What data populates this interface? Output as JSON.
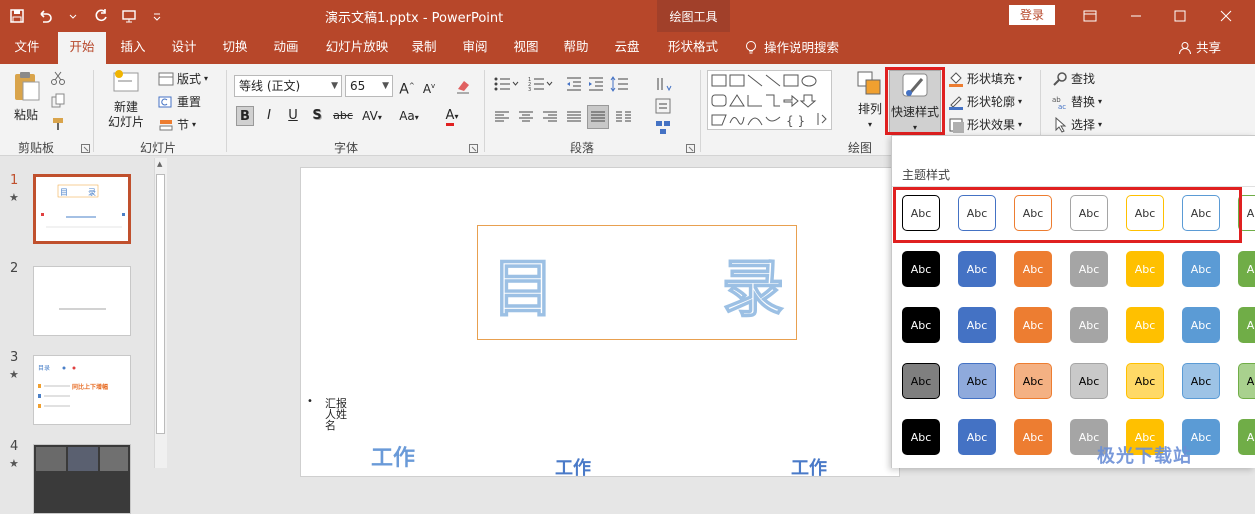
{
  "app": {
    "document_title": "演示文稿1.pptx  -  PowerPoint",
    "context_group": "绘图工具",
    "login_label": "登录"
  },
  "tabs": [
    {
      "label": "文件"
    },
    {
      "label": "开始"
    },
    {
      "label": "插入"
    },
    {
      "label": "设计"
    },
    {
      "label": "切换"
    },
    {
      "label": "动画"
    },
    {
      "label": "幻灯片放映"
    },
    {
      "label": "录制"
    },
    {
      "label": "审阅"
    },
    {
      "label": "视图"
    },
    {
      "label": "帮助"
    },
    {
      "label": "云盘"
    },
    {
      "label": "形状格式"
    }
  ],
  "tell_me": "操作说明搜索",
  "share": "共享",
  "ribbon": {
    "clipboard": {
      "label": "剪贴板",
      "paste": "粘贴"
    },
    "slides": {
      "label": "幻灯片",
      "new_slide": "新建\n幻灯片",
      "layout": "版式",
      "reset": "重置",
      "section": "节"
    },
    "font": {
      "label": "字体",
      "font_name": "等线 (正文)",
      "font_size": "65",
      "bold": "B",
      "italic": "I",
      "underline": "U",
      "shadow": "S",
      "strike": "abc",
      "spacing": "AV",
      "case": "Aa",
      "color": "A"
    },
    "paragraph": {
      "label": "段落"
    },
    "drawing": {
      "label": "绘图",
      "arrange": "排列",
      "quick_styles": "快速样式",
      "shape_fill": "形状填充",
      "shape_outline": "形状轮廓",
      "shape_effects": "形状效果"
    },
    "editing": {
      "find": "查找",
      "replace": "替换",
      "select": "选择"
    }
  },
  "slides_panel": [
    {
      "num": "1",
      "star": "★"
    },
    {
      "num": "2",
      "star": ""
    },
    {
      "num": "3",
      "star": "★"
    },
    {
      "num": "4",
      "star": "★"
    }
  ],
  "slide": {
    "title_left": "目",
    "title_right": "录",
    "bullet": "•",
    "reporter": "汇报\n人姓\n名",
    "work1": "工作",
    "work2": "工作",
    "work3": "工作"
  },
  "quick_styles": {
    "heading": "主题样式",
    "abc": "Abc",
    "rows": [
      [
        "#ffffff",
        "#ffffff",
        "#ffffff",
        "#ffffff",
        "#ffffff",
        "#ffffff",
        "#ffffff"
      ],
      [
        "#000000",
        "#4472c4",
        "#ed7d31",
        "#a5a5a5",
        "#ffc000",
        "#5b9bd5",
        "#70ad47"
      ],
      [
        "#000000",
        "#4472c4",
        "#ed7d31",
        "#a5a5a5",
        "#ffc000",
        "#5b9bd5",
        "#70ad47"
      ],
      [
        "#7f7f7f",
        "#8faadc",
        "#f4b183",
        "#c9c9c9",
        "#ffd966",
        "#9dc3e6",
        "#a9d18e"
      ],
      [
        "#000000",
        "#4472c4",
        "#ed7d31",
        "#a5a5a5",
        "#ffc000",
        "#5b9bd5",
        "#70ad47"
      ]
    ],
    "outline_colors": [
      "#000000",
      "#4472c4",
      "#ed7d31",
      "#a5a5a5",
      "#ffc000",
      "#5b9bd5",
      "#70ad47"
    ]
  },
  "watermark": "极光下载站"
}
